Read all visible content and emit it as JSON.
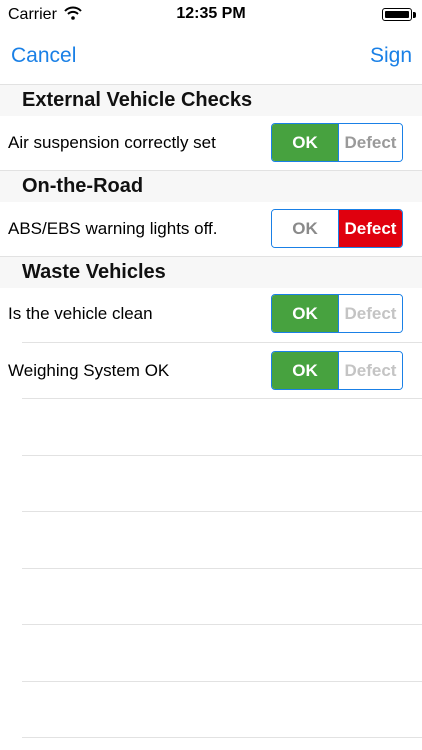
{
  "status_bar": {
    "carrier": "Carrier",
    "time": "12:35 PM"
  },
  "nav": {
    "cancel_label": "Cancel",
    "sign_label": "Sign"
  },
  "sections": [
    {
      "title": "External Vehicle Checks",
      "items": [
        {
          "label": "Air suspension correctly set",
          "ok_label": "OK",
          "defect_label": "Defect",
          "selected": "ok"
        }
      ]
    },
    {
      "title": "On-the-Road",
      "items": [
        {
          "label": "ABS/EBS warning lights off.",
          "ok_label": "OK",
          "defect_label": "Defect",
          "selected": "defect"
        }
      ]
    },
    {
      "title": "Waste Vehicles",
      "items": [
        {
          "label": "Is the vehicle clean",
          "ok_label": "OK",
          "defect_label": "Defect",
          "selected": "ok"
        },
        {
          "label": "Weighing System OK",
          "ok_label": "OK",
          "defect_label": "Defect",
          "selected": "ok"
        }
      ]
    }
  ],
  "colors": {
    "accent": "#1a80e6",
    "ok_green": "#47a23f",
    "defect_red": "#e0000e"
  }
}
